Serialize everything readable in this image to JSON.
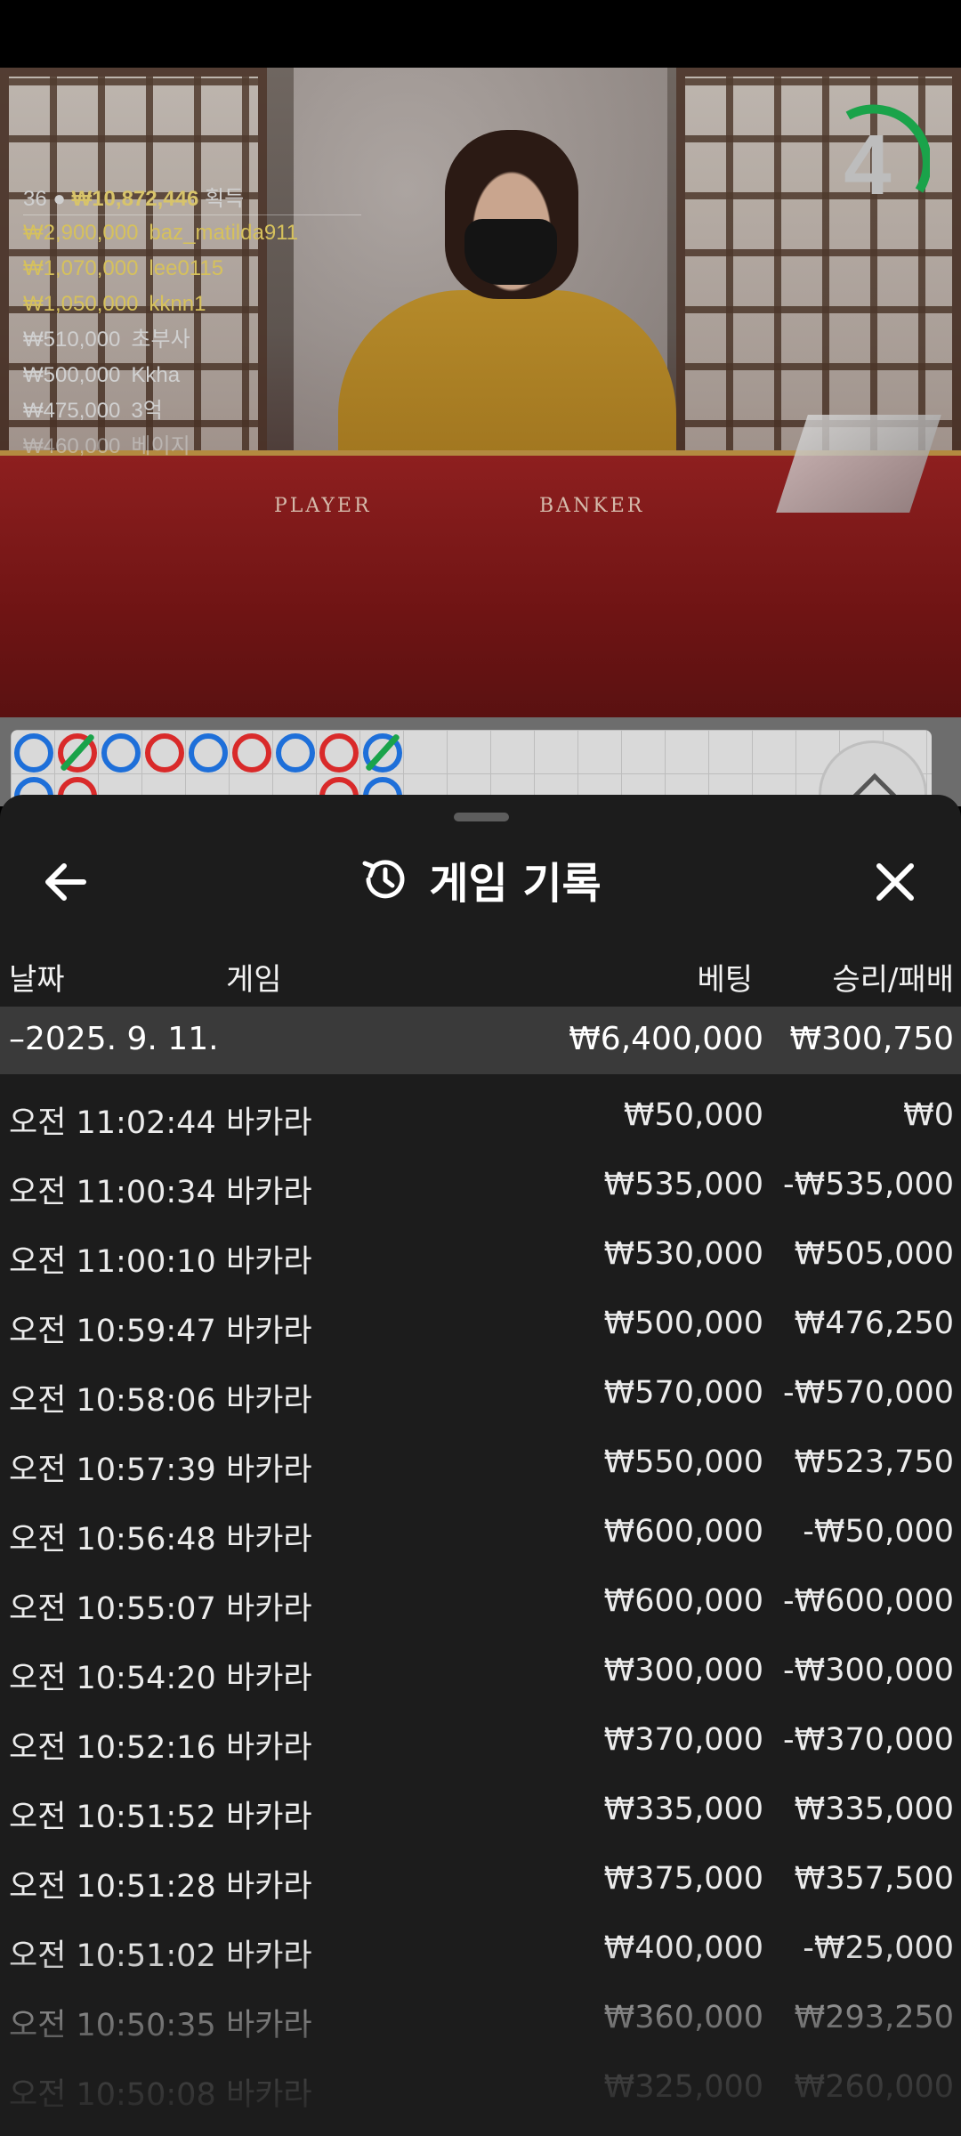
{
  "video": {
    "timer": "4",
    "table_labels": [
      "PLAYER",
      "BANKER"
    ],
    "winners_header": {
      "count": "36",
      "total": "₩10,872,446",
      "suffix": "획득"
    },
    "winners": [
      {
        "amount": "₩2,900,000",
        "name": "baz_matilda911",
        "tier": "gold"
      },
      {
        "amount": "₩1,070,000",
        "name": "lee0115",
        "tier": "gold"
      },
      {
        "amount": "₩1,050,000",
        "name": "kknn1",
        "tier": "gold"
      },
      {
        "amount": "₩510,000",
        "name": "초부사",
        "tier": "silver"
      },
      {
        "amount": "₩500,000",
        "name": "Kkha",
        "tier": "silver"
      },
      {
        "amount": "₩475,000",
        "name": "3억",
        "tier": "silver"
      },
      {
        "amount": "₩460,000",
        "name": "베이지",
        "tier": "fade"
      }
    ],
    "colors": {
      "player": "#1e6fd9",
      "banker": "#d92a2a",
      "tie": "#1aa34a",
      "timer_arc": "#1aa34a"
    }
  },
  "sheet": {
    "title": "게임 기록",
    "icons": {
      "back": "arrow-left-icon",
      "history": "history-icon",
      "close": "close-icon"
    },
    "columns": {
      "date": "날짜",
      "game": "게임",
      "bet": "베팅",
      "result": "승리/패배"
    },
    "day": {
      "label": "–2025. 9. 11.",
      "bet_total": "₩6,400,000",
      "result_total": "₩300,750"
    },
    "rows": [
      {
        "time": "오전 11:02:44",
        "game": "바카라",
        "bet": "₩50,000",
        "result": "₩0"
      },
      {
        "time": "오전 11:00:34",
        "game": "바카라",
        "bet": "₩535,000",
        "result": "-₩535,000"
      },
      {
        "time": "오전 11:00:10",
        "game": "바카라",
        "bet": "₩530,000",
        "result": "₩505,000"
      },
      {
        "time": "오전 10:59:47",
        "game": "바카라",
        "bet": "₩500,000",
        "result": "₩476,250"
      },
      {
        "time": "오전 10:58:06",
        "game": "바카라",
        "bet": "₩570,000",
        "result": "-₩570,000"
      },
      {
        "time": "오전 10:57:39",
        "game": "바카라",
        "bet": "₩550,000",
        "result": "₩523,750"
      },
      {
        "time": "오전 10:56:48",
        "game": "바카라",
        "bet": "₩600,000",
        "result": "-₩50,000"
      },
      {
        "time": "오전 10:55:07",
        "game": "바카라",
        "bet": "₩600,000",
        "result": "-₩600,000"
      },
      {
        "time": "오전 10:54:20",
        "game": "바카라",
        "bet": "₩300,000",
        "result": "-₩300,000"
      },
      {
        "time": "오전 10:52:16",
        "game": "바카라",
        "bet": "₩370,000",
        "result": "-₩370,000"
      },
      {
        "time": "오전 10:51:52",
        "game": "바카라",
        "bet": "₩335,000",
        "result": "₩335,000"
      },
      {
        "time": "오전 10:51:28",
        "game": "바카라",
        "bet": "₩375,000",
        "result": "₩357,500"
      },
      {
        "time": "오전 10:51:02",
        "game": "바카라",
        "bet": "₩400,000",
        "result": "-₩25,000"
      },
      {
        "time": "오전 10:50:35",
        "game": "바카라",
        "bet": "₩360,000",
        "result": "₩293,250"
      },
      {
        "time": "오전 10:50:08",
        "game": "바카라",
        "bet": "₩325,000",
        "result": "₩260,000"
      }
    ]
  }
}
